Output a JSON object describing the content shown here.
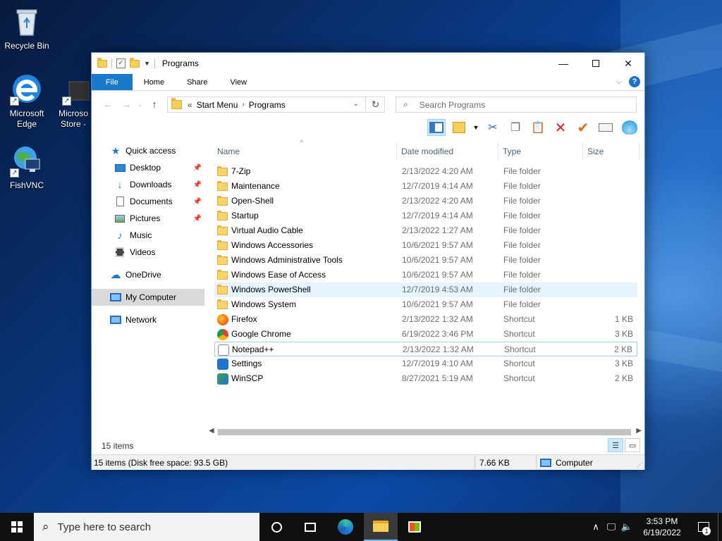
{
  "desktop": {
    "icons": [
      {
        "label": "Recycle Bin",
        "icon": "recycle-bin-icon"
      },
      {
        "label": "Microsoft\nEdge",
        "icon": "edge-icon"
      },
      {
        "label": "Microso\nStore -",
        "icon": "store-icon"
      },
      {
        "label": "FishVNC",
        "icon": "vnc-icon"
      }
    ]
  },
  "window": {
    "title": "Programs",
    "tabs": {
      "file": "File",
      "home": "Home",
      "share": "Share",
      "view": "View"
    },
    "breadcrumb": {
      "overflow": "«",
      "items": [
        "Start Menu",
        "Programs"
      ]
    },
    "search_placeholder": "Search Programs",
    "nav": {
      "quick_access": "Quick access",
      "desktop": "Desktop",
      "downloads": "Downloads",
      "documents": "Documents",
      "pictures": "Pictures",
      "music": "Music",
      "videos": "Videos",
      "onedrive": "OneDrive",
      "my_computer": "My Computer",
      "network": "Network"
    },
    "columns": {
      "name": "Name",
      "date": "Date modified",
      "type": "Type",
      "size": "Size"
    },
    "files": [
      {
        "name": "7-Zip",
        "date": "2/13/2022 4:20 AM",
        "type": "File folder",
        "size": "",
        "icon": "folder"
      },
      {
        "name": "Maintenance",
        "date": "12/7/2019 4:14 AM",
        "type": "File folder",
        "size": "",
        "icon": "folder"
      },
      {
        "name": "Open-Shell",
        "date": "2/13/2022 4:20 AM",
        "type": "File folder",
        "size": "",
        "icon": "folder"
      },
      {
        "name": "Startup",
        "date": "12/7/2019 4:14 AM",
        "type": "File folder",
        "size": "",
        "icon": "folder"
      },
      {
        "name": "Virtual Audio Cable",
        "date": "2/13/2022 1:27 AM",
        "type": "File folder",
        "size": "",
        "icon": "folder"
      },
      {
        "name": "Windows Accessories",
        "date": "10/6/2021 9:57 AM",
        "type": "File folder",
        "size": "",
        "icon": "folder"
      },
      {
        "name": "Windows Administrative Tools",
        "date": "10/6/2021 9:57 AM",
        "type": "File folder",
        "size": "",
        "icon": "folder"
      },
      {
        "name": "Windows Ease of Access",
        "date": "10/6/2021 9:57 AM",
        "type": "File folder",
        "size": "",
        "icon": "folder"
      },
      {
        "name": "Windows PowerShell",
        "date": "12/7/2019 4:53 AM",
        "type": "File folder",
        "size": "",
        "icon": "folder"
      },
      {
        "name": "Windows System",
        "date": "10/6/2021 9:57 AM",
        "type": "File folder",
        "size": "",
        "icon": "folder"
      },
      {
        "name": "Firefox",
        "date": "2/13/2022 1:32 AM",
        "type": "Shortcut",
        "size": "1 KB",
        "icon": "firefox"
      },
      {
        "name": "Google Chrome",
        "date": "6/19/2022 3:46 PM",
        "type": "Shortcut",
        "size": "3 KB",
        "icon": "chrome"
      },
      {
        "name": "Notepad++",
        "date": "2/13/2022 1:32 AM",
        "type": "Shortcut",
        "size": "2 KB",
        "icon": "notepadpp"
      },
      {
        "name": "Settings",
        "date": "12/7/2019 4:10 AM",
        "type": "Shortcut",
        "size": "3 KB",
        "icon": "settings"
      },
      {
        "name": "WinSCP",
        "date": "8/27/2021 5:19 AM",
        "type": "Shortcut",
        "size": "2 KB",
        "icon": "winscp"
      }
    ],
    "status": {
      "item_count": "15 items",
      "detail": "15 items (Disk free space: 93.5 GB)",
      "selection_size": "7.66 KB",
      "location": "Computer"
    }
  },
  "taskbar": {
    "search_placeholder": "Type here to search",
    "time": "3:53 PM",
    "date": "6/19/2022",
    "notification_count": "1"
  },
  "colors": {
    "accent": "#1979ca",
    "hover": "#e5f3ff",
    "taskbar": "#101010"
  }
}
